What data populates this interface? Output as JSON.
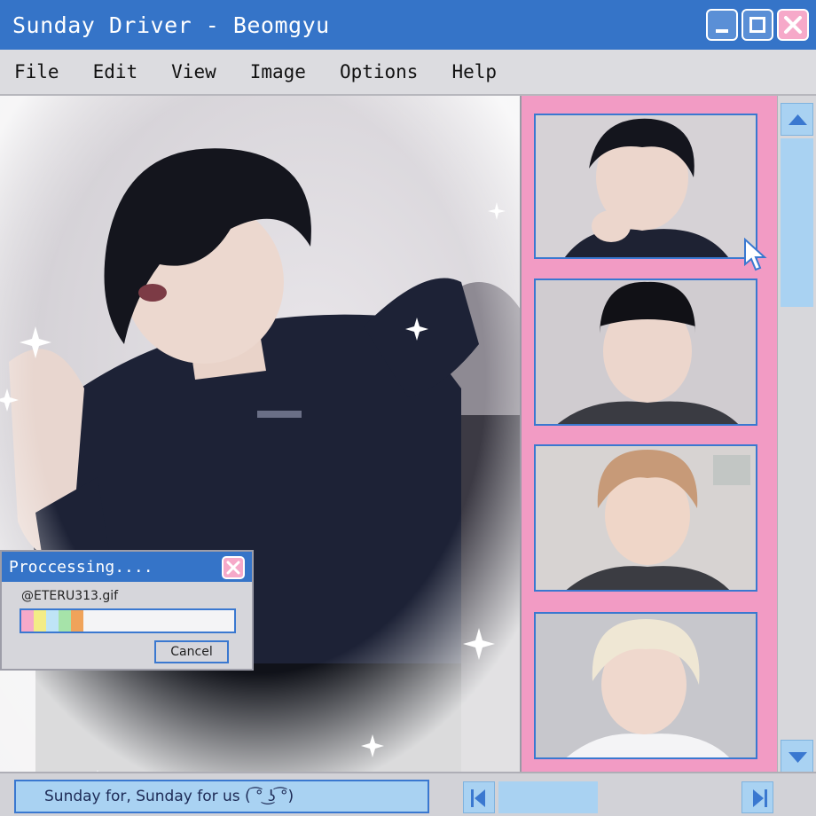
{
  "window": {
    "title": "Sunday Driver - Beomgyu"
  },
  "menu": {
    "items": [
      "File",
      "Edit",
      "View",
      "Image",
      "Options",
      "Help"
    ]
  },
  "dialog": {
    "title": "Proccessing....",
    "filename": "@ETERU313.gif",
    "progress": 0.3,
    "cancel_label": "Cancel",
    "progress_colors": [
      "#f6a9c9",
      "#f3ec86",
      "#bfe4f6",
      "#a6e3a9",
      "#f0a35a"
    ]
  },
  "status": {
    "text": "Sunday for, Sunday for us ( ͡° ͜ʖ ͡°)"
  },
  "colors": {
    "titlebar": "#3574c8",
    "strip": "#f29bc4",
    "accent_light_blue": "#a9d2f2",
    "close_pink": "#f6a9c9"
  }
}
